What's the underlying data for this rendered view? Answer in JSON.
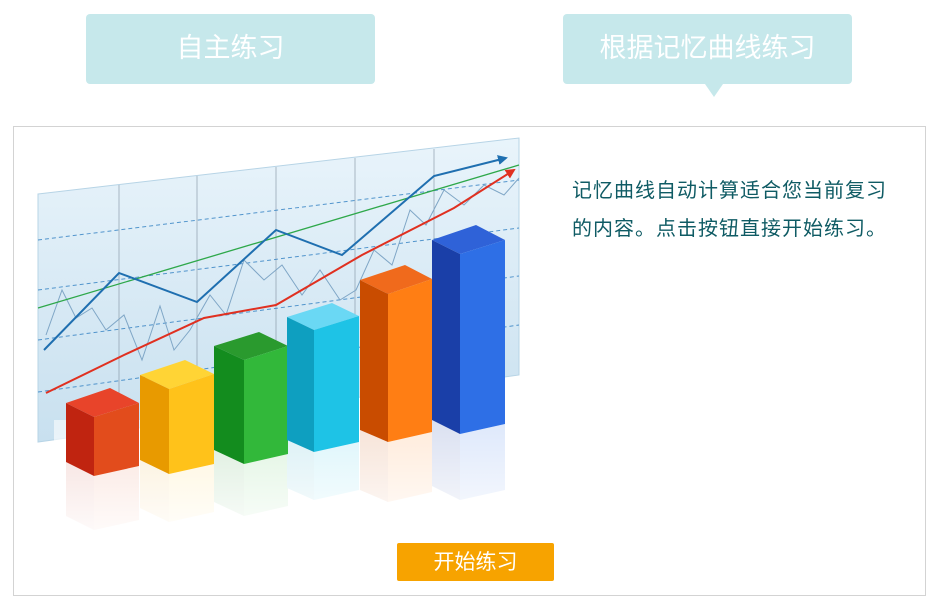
{
  "tabs": [
    {
      "label": "自主练习",
      "selected": false
    },
    {
      "label": "根据记忆曲线练习",
      "selected": true
    }
  ],
  "colors": {
    "tab_bg": "#c6e8eb",
    "button_bg": "#f7a300",
    "text": "#0f5b64"
  },
  "panel": {
    "illustration": "3d-bar-chart-icon",
    "description": "记忆曲线自动计算适合您当前复习的内容。点击按钮直接开始练习。",
    "start_button": "开始练习"
  }
}
